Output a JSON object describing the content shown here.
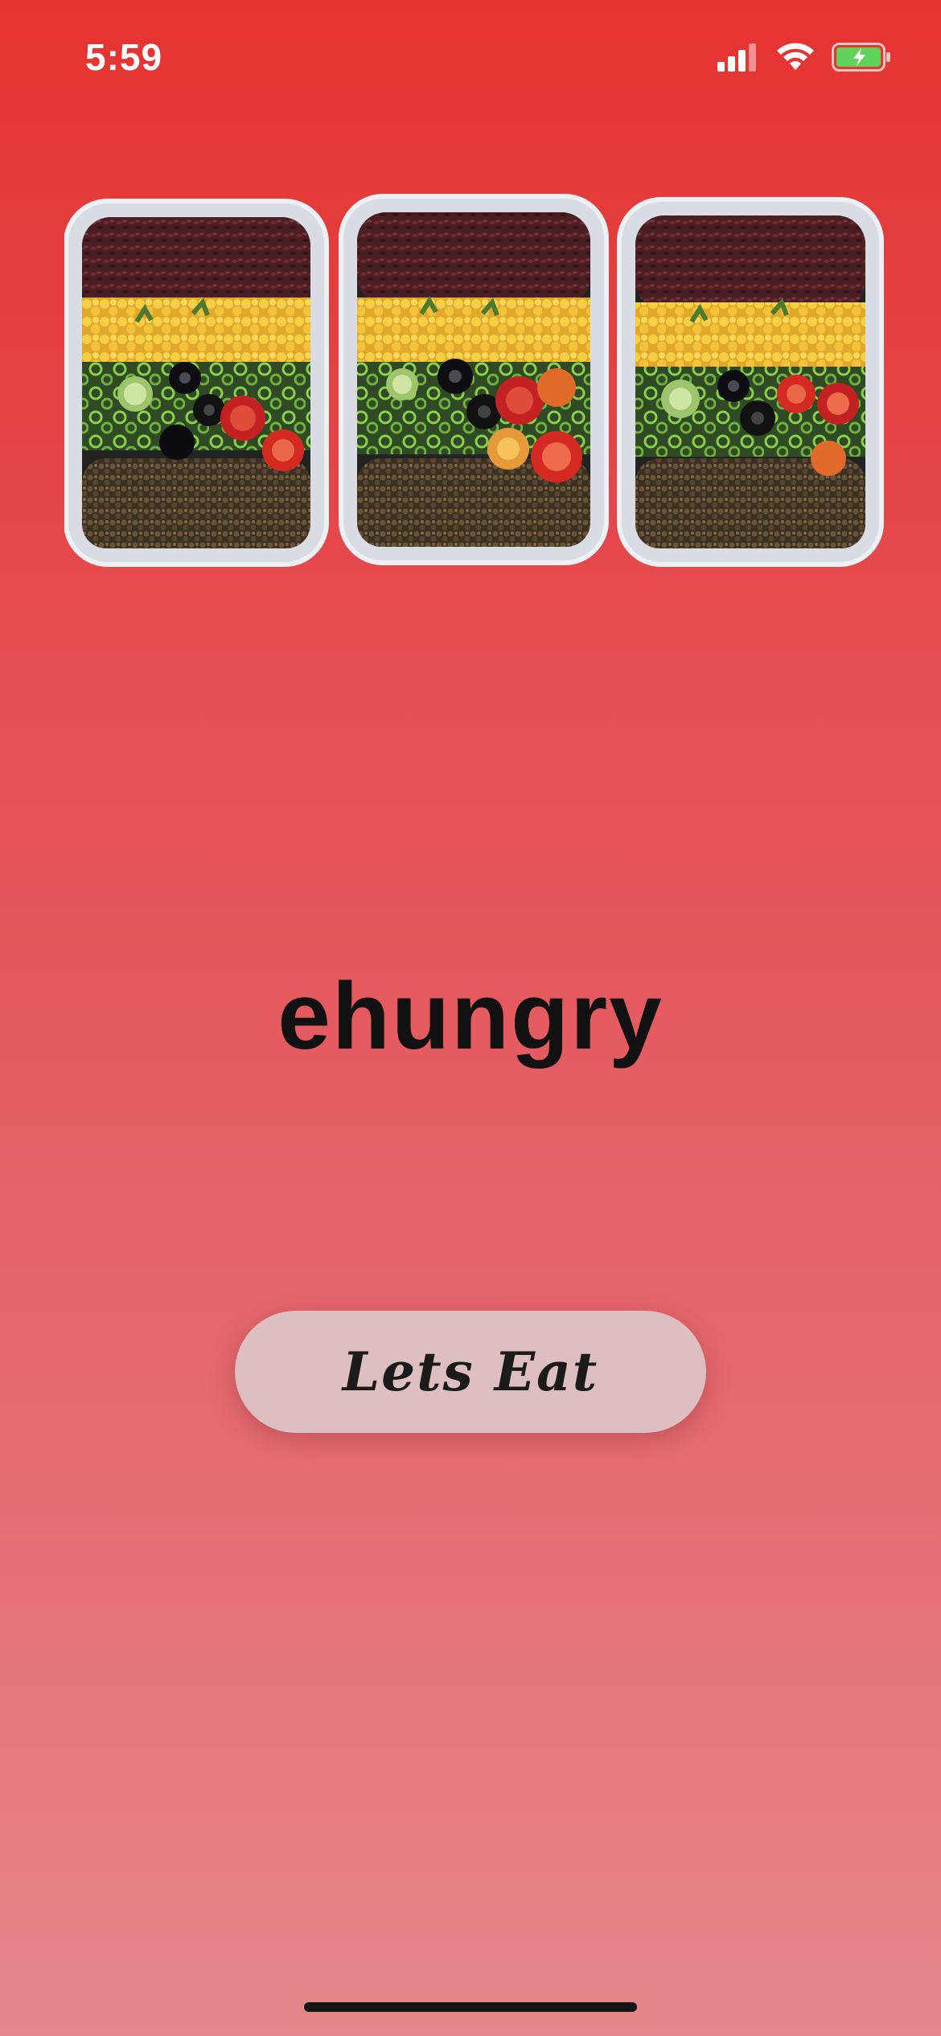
{
  "status_bar": {
    "time": "5:59",
    "icons": [
      "cellular-signal-icon",
      "wifi-icon",
      "battery-charging-icon"
    ],
    "colors": {
      "text": "#ffffff",
      "battery_fill": "#5fd35a"
    }
  },
  "hero": {
    "image": "meal-prep-containers",
    "containers": 3
  },
  "brand": {
    "logo_text": "ehungry",
    "logo_color": "#111111"
  },
  "cta": {
    "label": "Lets Eat",
    "background": "#ddbfc2"
  },
  "theme": {
    "gradient_top": "#e53330",
    "gradient_bottom": "#e5878b"
  }
}
